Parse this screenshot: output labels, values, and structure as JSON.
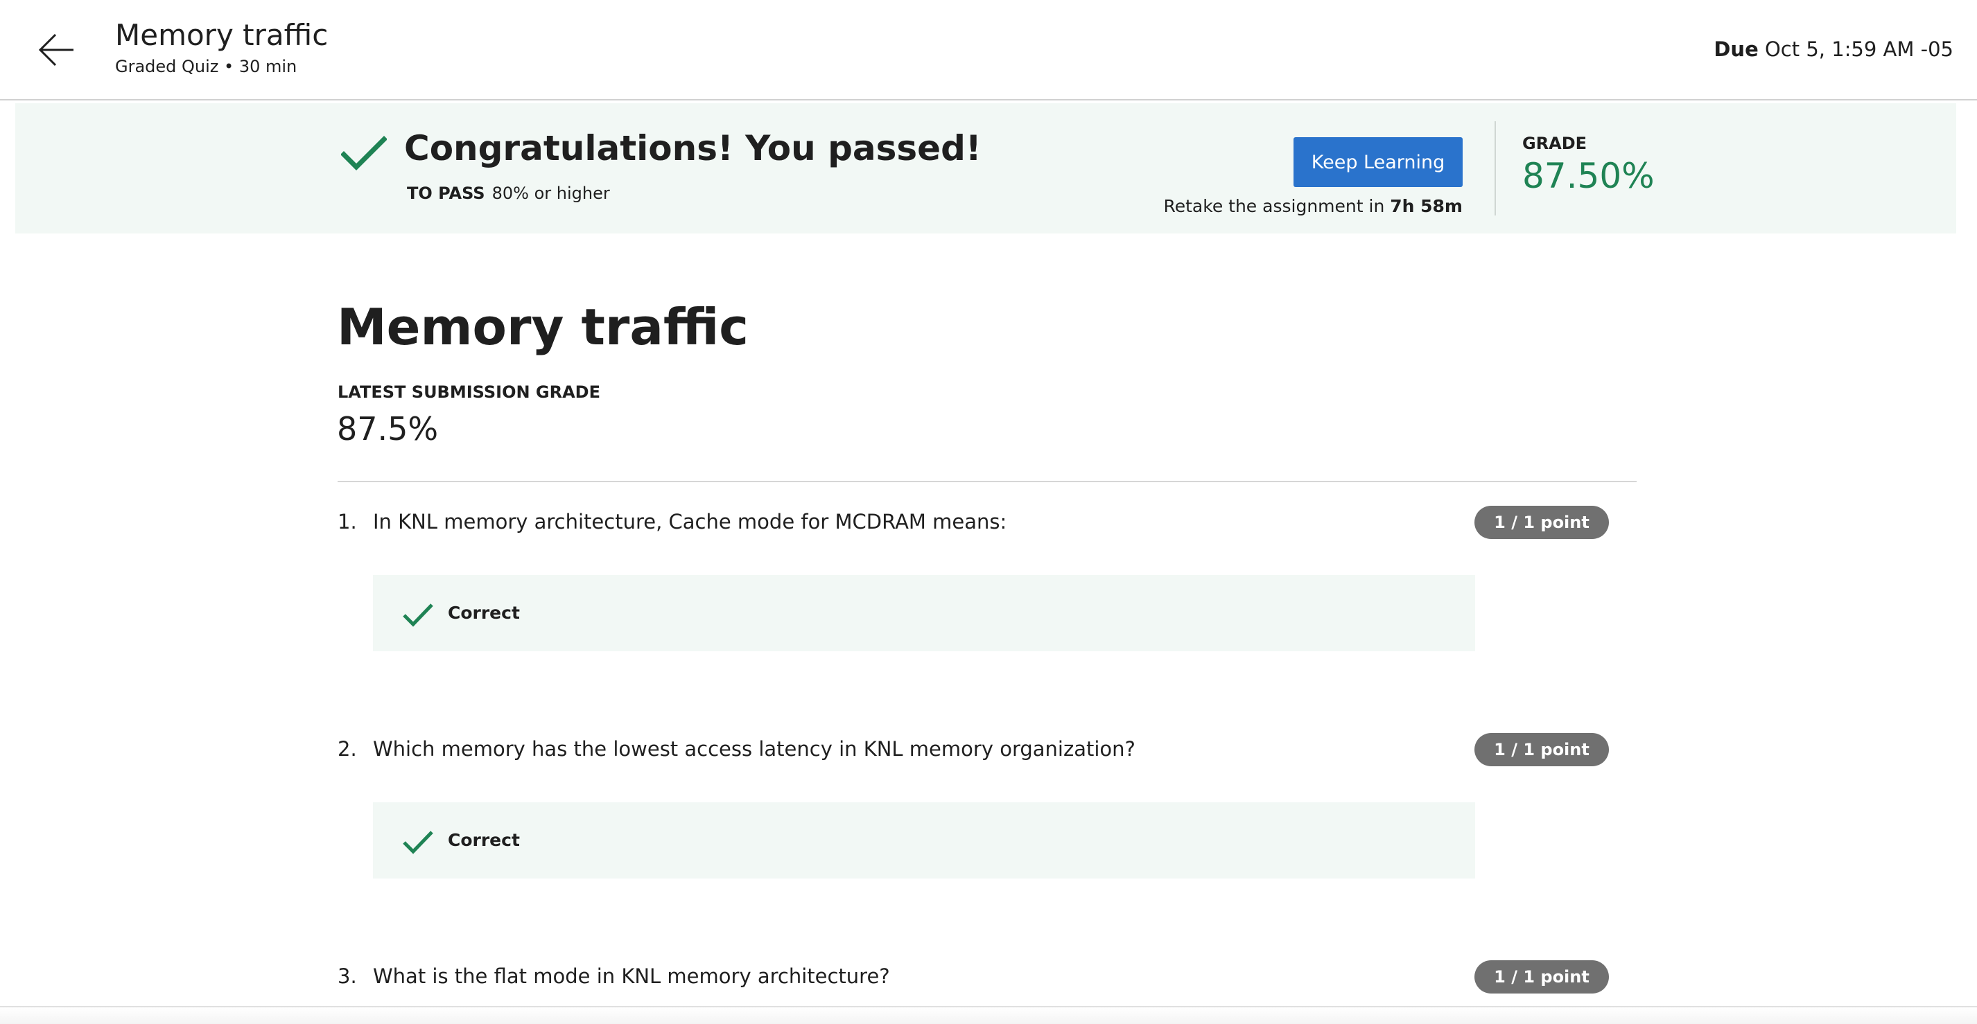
{
  "header": {
    "title": "Memory traffic",
    "subtitle": "Graded Quiz • 30 min",
    "due_label": "Due",
    "due_value": "Oct 5, 1:59 AM -05"
  },
  "banner": {
    "title": "Congratulations! You passed!",
    "to_pass_label": "TO PASS",
    "to_pass_value": "80% or higher",
    "keep_learning_label": "Keep Learning",
    "retake_prefix": "Retake the assignment in",
    "retake_time": "7h 58m",
    "grade_label": "GRADE",
    "grade_value": "87.50%"
  },
  "main": {
    "title": "Memory traffic",
    "latest_label": "LATEST SUBMISSION GRADE",
    "latest_value": "87.5%"
  },
  "questions": [
    {
      "number": "1.",
      "text": "In KNL memory architecture, Cache mode for MCDRAM means:",
      "points": "1 / 1 point",
      "feedback": "Correct"
    },
    {
      "number": "2.",
      "text": "Which memory has the lowest access latency in KNL memory organization?",
      "points": "1 / 1 point",
      "feedback": "Correct"
    },
    {
      "number": "3.",
      "text": "What is the flat mode in KNL memory architecture?",
      "points": "1 / 1 point"
    }
  ],
  "colors": {
    "accent_blue": "#2a73cc",
    "success_green": "#1f8354",
    "banner_bg": "#f2f8f5",
    "badge_gray": "#707070"
  },
  "icons": {
    "back": "arrow-left-icon",
    "pass": "checkmark-icon",
    "correct": "checkmark-icon"
  }
}
